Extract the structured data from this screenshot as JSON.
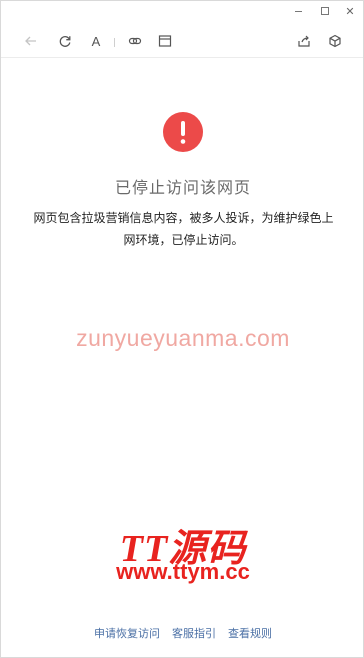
{
  "window": {
    "controls": {
      "minimize_icon": "minimize-icon",
      "maximize_icon": "maximize-icon",
      "close_icon": "close-icon",
      "close_glyph": "✕"
    }
  },
  "toolbar": {
    "font_label": "A",
    "icons": [
      "back-arrow-icon",
      "refresh-icon",
      "font-icon",
      "link-icon",
      "reader-icon",
      "share-icon",
      "cube-icon"
    ]
  },
  "main": {
    "alert_icon": "exclamation-icon",
    "alert_color": "#ec4a49",
    "title": "已停止访问该网页",
    "description": "网页包含拉圾营销信息内容，被多人投诉，为维护绿色上网环境，已停止访问。"
  },
  "watermark": {
    "url": "zunyueyuanma.com",
    "brand": "TT源码",
    "site": "www.ttym.cc"
  },
  "footer": {
    "links": [
      "申请恢复访问",
      "客服指引",
      "查看规则"
    ]
  }
}
